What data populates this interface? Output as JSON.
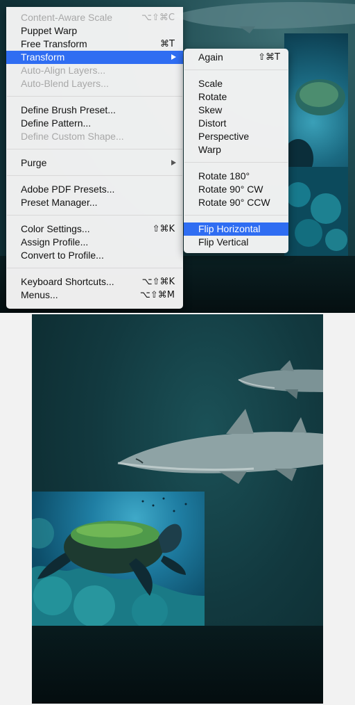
{
  "main_menu": {
    "items": [
      {
        "label": "Content-Aware Scale",
        "shortcut": "⌥⇧⌘C",
        "enabled": false,
        "submenu": false
      },
      {
        "label": "Puppet Warp",
        "shortcut": "",
        "enabled": true,
        "submenu": false
      },
      {
        "label": "Free Transform",
        "shortcut": "⌘T",
        "enabled": true,
        "submenu": false
      },
      {
        "label": "Transform",
        "shortcut": "",
        "enabled": true,
        "submenu": true,
        "highlighted": true
      },
      {
        "label": "Auto-Align Layers...",
        "shortcut": "",
        "enabled": false,
        "submenu": false
      },
      {
        "label": "Auto-Blend Layers...",
        "shortcut": "",
        "enabled": false,
        "submenu": false
      },
      {
        "label": "Define Brush Preset...",
        "shortcut": "",
        "enabled": true,
        "submenu": false
      },
      {
        "label": "Define Pattern...",
        "shortcut": "",
        "enabled": true,
        "submenu": false
      },
      {
        "label": "Define Custom Shape...",
        "shortcut": "",
        "enabled": false,
        "submenu": false
      },
      {
        "label": "Purge",
        "shortcut": "",
        "enabled": true,
        "submenu": true
      },
      {
        "label": "Adobe PDF Presets...",
        "shortcut": "",
        "enabled": true,
        "submenu": false
      },
      {
        "label": "Preset Manager...",
        "shortcut": "",
        "enabled": true,
        "submenu": false
      },
      {
        "label": "Color Settings...",
        "shortcut": "⇧⌘K",
        "enabled": true,
        "submenu": false
      },
      {
        "label": "Assign Profile...",
        "shortcut": "",
        "enabled": true,
        "submenu": false
      },
      {
        "label": "Convert to Profile...",
        "shortcut": "",
        "enabled": true,
        "submenu": false
      },
      {
        "label": "Keyboard Shortcuts...",
        "shortcut": "⌥⇧⌘K",
        "enabled": true,
        "submenu": false
      },
      {
        "label": "Menus...",
        "shortcut": "⌥⇧⌘M",
        "enabled": true,
        "submenu": false
      }
    ]
  },
  "transform_submenu": {
    "items": [
      {
        "label": "Again",
        "shortcut": "⇧⌘T"
      },
      {
        "label": "Scale",
        "shortcut": ""
      },
      {
        "label": "Rotate",
        "shortcut": ""
      },
      {
        "label": "Skew",
        "shortcut": ""
      },
      {
        "label": "Distort",
        "shortcut": ""
      },
      {
        "label": "Perspective",
        "shortcut": ""
      },
      {
        "label": "Warp",
        "shortcut": ""
      },
      {
        "label": "Rotate 180°",
        "shortcut": ""
      },
      {
        "label": "Rotate 90° CW",
        "shortcut": ""
      },
      {
        "label": "Rotate 90° CCW",
        "shortcut": ""
      },
      {
        "label": "Flip Horizontal",
        "shortcut": "",
        "highlighted": true
      },
      {
        "label": "Flip Vertical",
        "shortcut": ""
      }
    ]
  },
  "colors": {
    "highlight": "#2f6df2",
    "disabled_text": "#a8a8a8",
    "menu_bg": "#f5f5f5",
    "water": "#12393f"
  }
}
